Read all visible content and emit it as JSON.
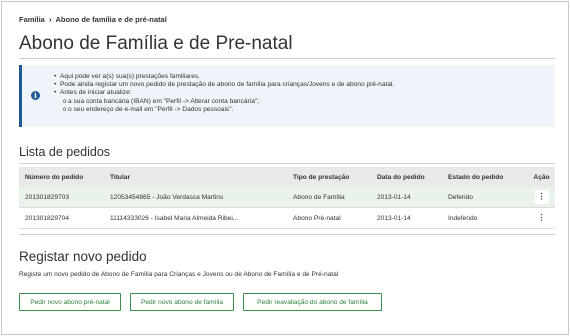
{
  "breadcrumb": {
    "home": "Família",
    "separator": "›",
    "current": "Abono de família e de pré-natal"
  },
  "page_title": "Abono de Família e de Pre-natal",
  "info": {
    "icon": "info-icon",
    "bullets": [
      "Aqui pode ver a(s) sua(s) prestações familiares.",
      "Pode ainda registar um novo pedido de prestação de abono de família para crianças/Jovens e de abono pré-natal.",
      "Antes de iniciar atualize:"
    ],
    "sub_bullets": [
      "a sua conta bancária (IBAN) em \"Perfil -> Alterar conta bancária\";",
      "o seu endereço de e-mail em \"Perfil -> Dados pessoais\"."
    ]
  },
  "requests": {
    "title": "Lista de pedidos",
    "columns": [
      "Número do pedido",
      "Titular",
      "Tipo de prestação",
      "Data do pedido",
      "Estado do pedido",
      "Ação"
    ],
    "rows": [
      {
        "numero": "201301829703",
        "titular": "12053454865 - João Verdasca Martins",
        "tipo": "Abono de Família",
        "data": "2013-01-14",
        "estado": "Deferido",
        "acao": "⋮"
      },
      {
        "numero": "201301829704",
        "titular": "11114333026 - Isabel Maria Almeida Ribei...",
        "tipo": "Abono Pré-natal",
        "data": "2013-01-14",
        "estado": "Indeferido",
        "acao": "⋮"
      }
    ]
  },
  "register": {
    "title": "Registar novo pedido",
    "description": "Registe um novo pedido de Abono de Família para Crianças e Jovens ou de Abono de Família e de Pré-natal",
    "buttons": [
      "Pedir novo abono pré-natal",
      "Pedir novo abono de família",
      "Pedir reavaliação do abono de família"
    ]
  },
  "colors": {
    "accent_green": "#3f8f4a",
    "info_blue": "#1f5a96",
    "info_bg": "#eef4fa",
    "row_highlight": "#e9f3ea"
  }
}
